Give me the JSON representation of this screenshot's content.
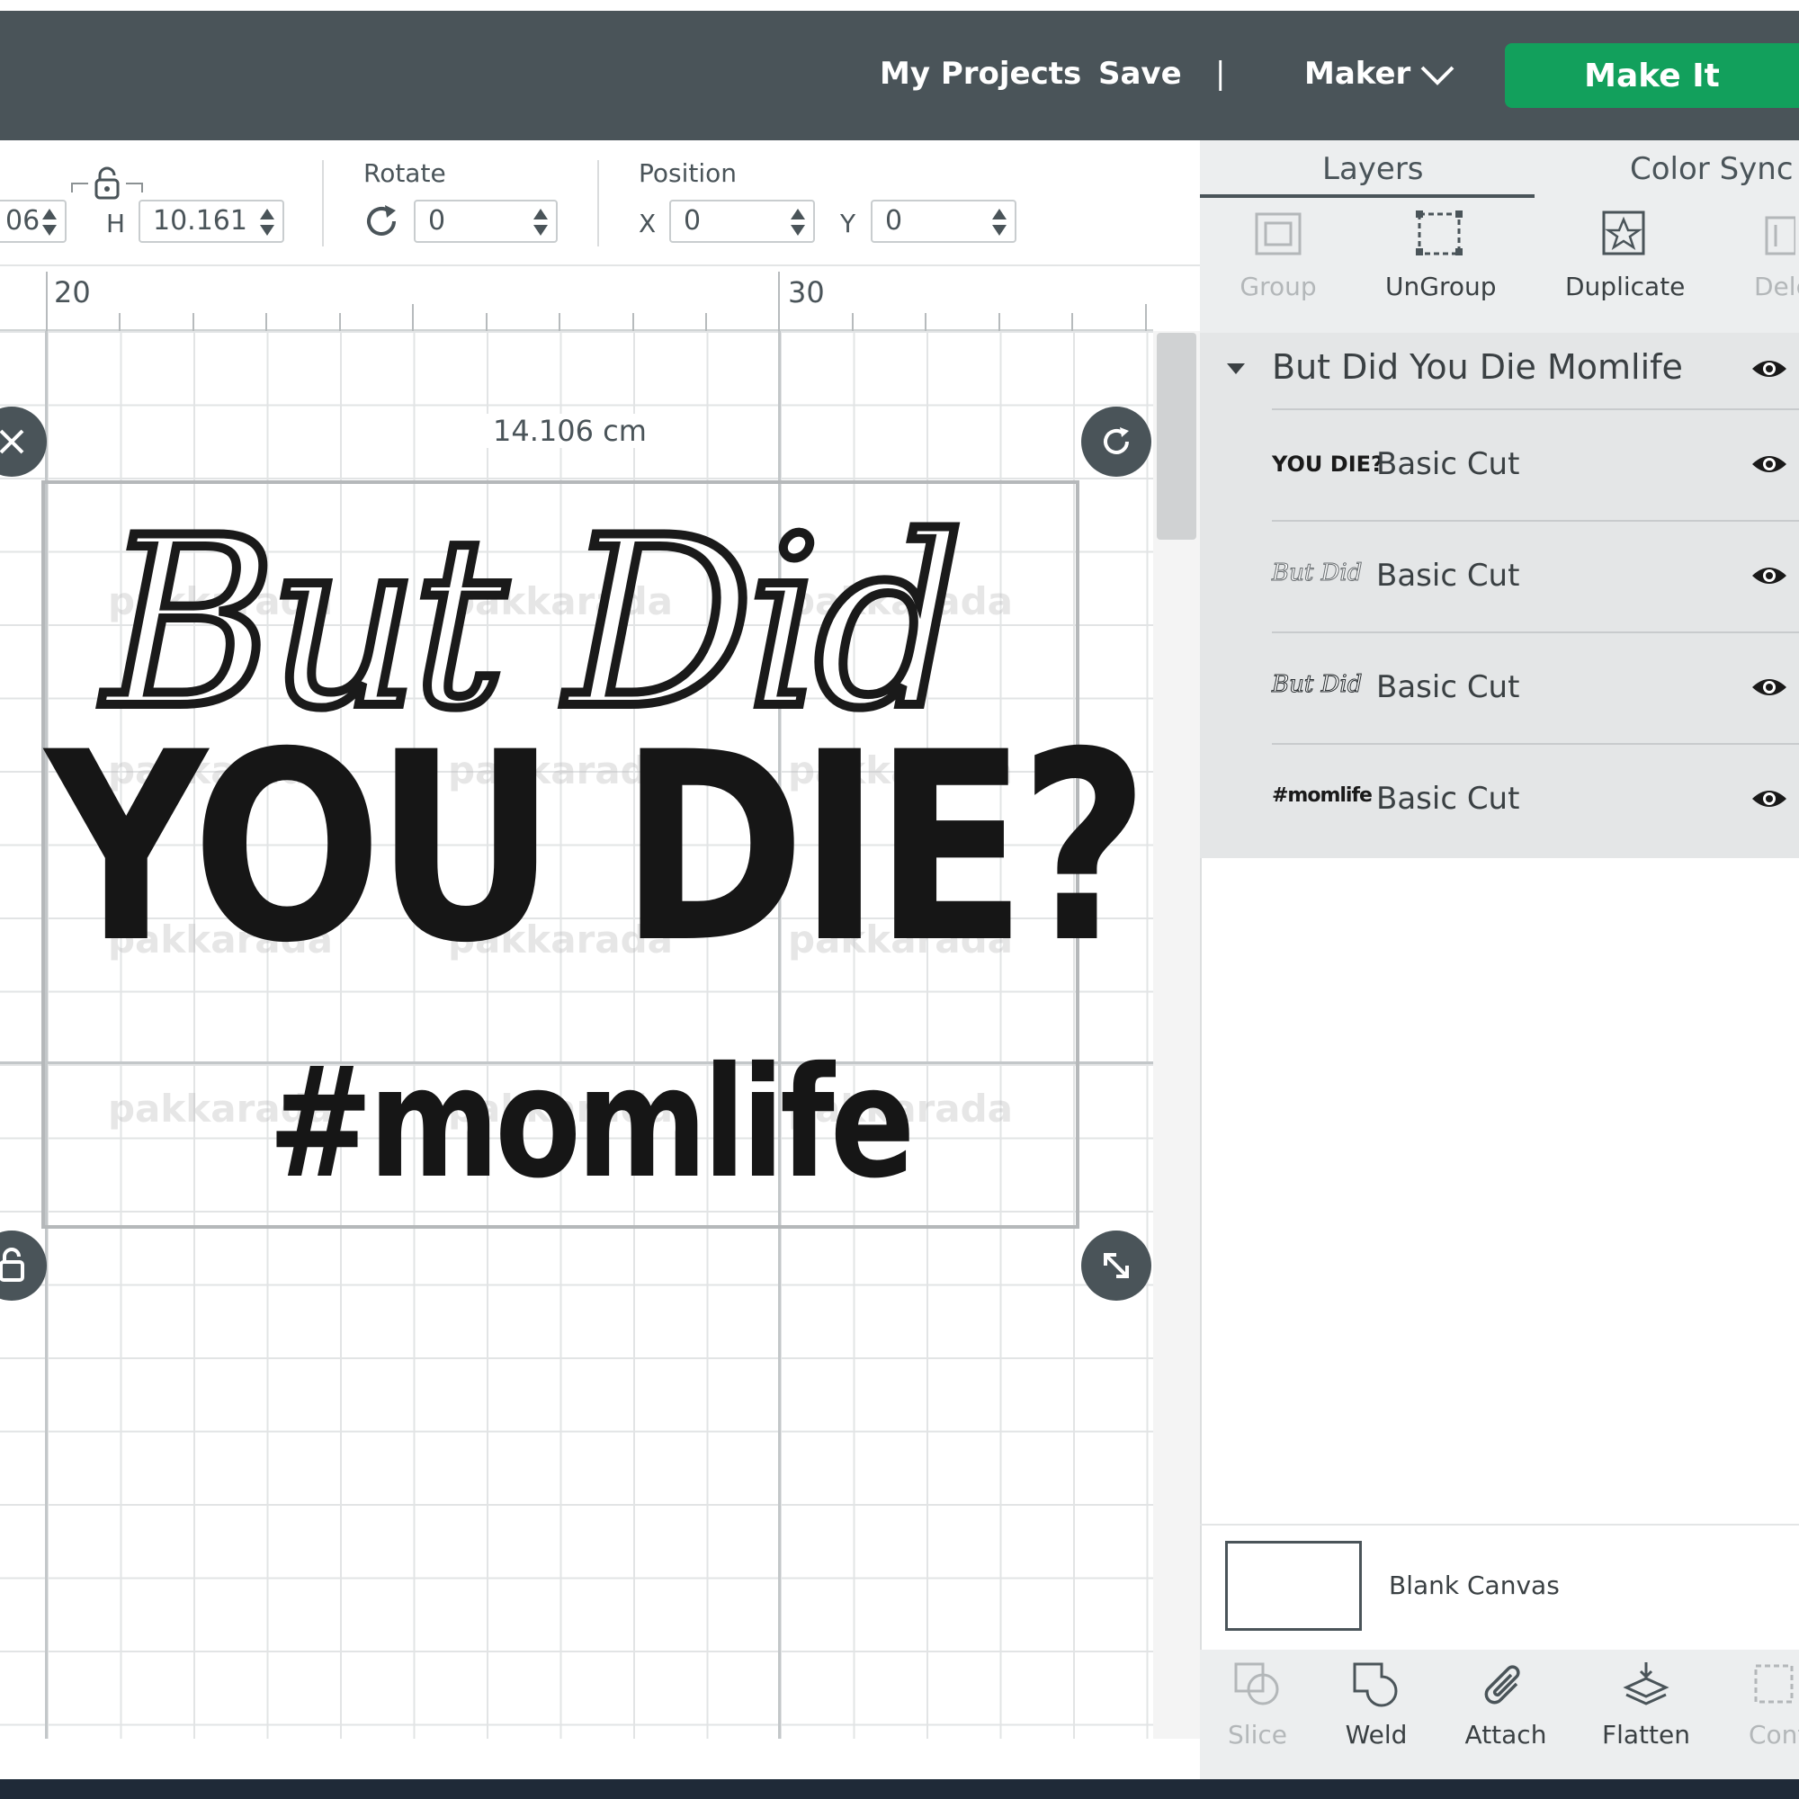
{
  "header": {
    "my_projects": "My Projects",
    "save": "Save",
    "divider": "|",
    "machine": "Maker",
    "make_it": "Make It"
  },
  "toolbar": {
    "width_value": "06",
    "height_label": "H",
    "height_value": "10.161",
    "rotate_label": "Rotate",
    "rotate_value": "0",
    "position_label": "Position",
    "x_label": "X",
    "x_value": "0",
    "y_label": "Y",
    "y_value": "0"
  },
  "ruler": {
    "marks": [
      "20",
      "30"
    ]
  },
  "canvas": {
    "dimension_label": "14.106 cm",
    "design_lines": [
      "But Did",
      "YOU DIE?",
      "#momlife"
    ],
    "watermark": "pakkarada"
  },
  "panel": {
    "tabs": [
      "Layers",
      "Color Sync"
    ],
    "top_actions": [
      {
        "label": "Group",
        "enabled": false
      },
      {
        "label": "UnGroup",
        "enabled": true
      },
      {
        "label": "Duplicate",
        "enabled": true
      },
      {
        "label": "Dele",
        "enabled": false
      }
    ],
    "group_name": "But Did You Die Momlife",
    "layers": [
      {
        "thumb": "YOU DIE?",
        "name": "Basic Cut"
      },
      {
        "thumb": "But Did",
        "name": "Basic Cut"
      },
      {
        "thumb": "But Did",
        "name": "Basic Cut"
      },
      {
        "thumb": "#momlife",
        "name": "Basic Cut"
      }
    ],
    "blank_canvas": "Blank Canvas",
    "bottom_actions": [
      {
        "label": "Slice",
        "enabled": false
      },
      {
        "label": "Weld",
        "enabled": true
      },
      {
        "label": "Attach",
        "enabled": true
      },
      {
        "label": "Flatten",
        "enabled": true
      },
      {
        "label": "Cont",
        "enabled": false
      }
    ]
  },
  "colors": {
    "header": "#4a5459",
    "accent": "#12a05c",
    "panel": "#eceeef"
  }
}
